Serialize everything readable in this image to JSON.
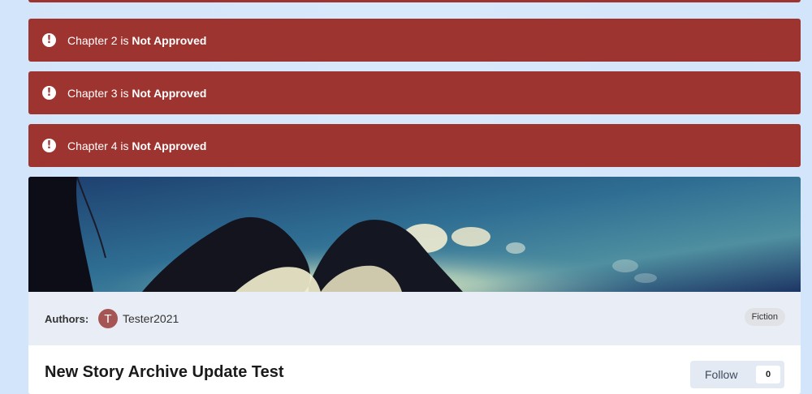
{
  "alerts": [
    {
      "prefix": "Chapter 2 is ",
      "status": "Not Approved"
    },
    {
      "prefix": "Chapter 3 is ",
      "status": "Not Approved"
    },
    {
      "prefix": "Chapter 4 is ",
      "status": "Not Approved"
    }
  ],
  "alert_icon": "exclamation-circle-icon",
  "alert_color": "#9e3430",
  "meta": {
    "authors_label": "Authors:",
    "author_initial": "T",
    "author_name": "Tester2021",
    "tag": "Fiction"
  },
  "story": {
    "title": "New Story Archive Update Test",
    "follow_label": "Follow",
    "follow_count": "0"
  }
}
